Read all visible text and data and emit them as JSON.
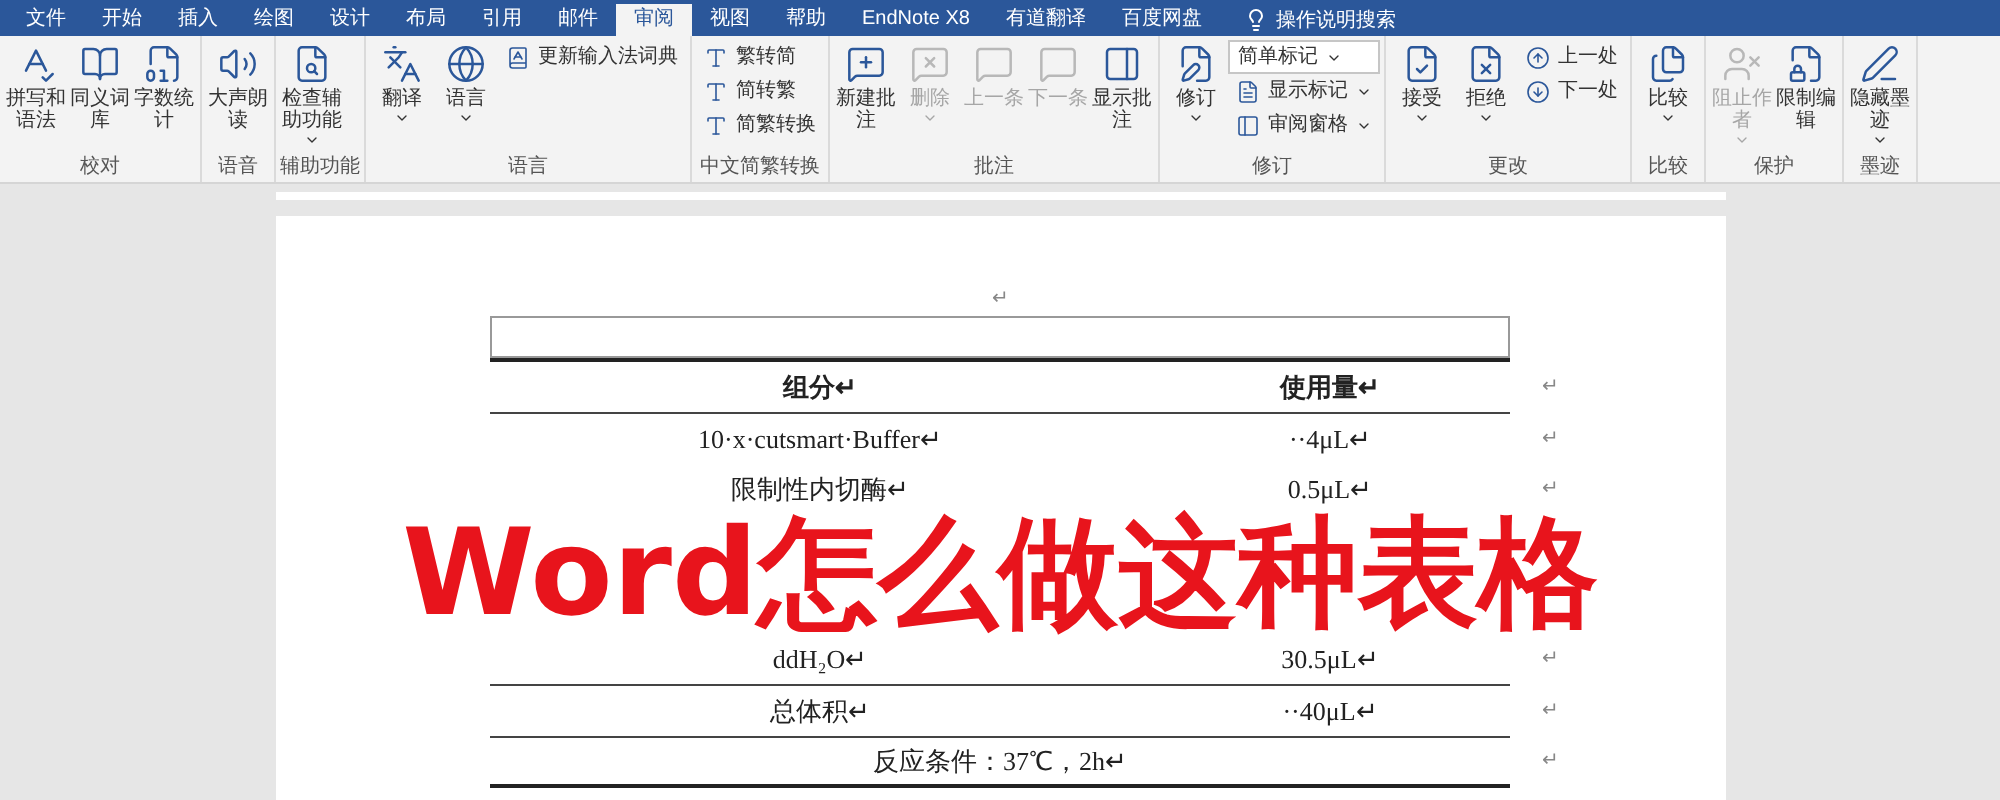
{
  "menu_tabs": [
    {
      "label": "文件",
      "selected": false
    },
    {
      "label": "开始",
      "selected": false
    },
    {
      "label": "插入",
      "selected": false
    },
    {
      "label": "绘图",
      "selected": false
    },
    {
      "label": "设计",
      "selected": false
    },
    {
      "label": "布局",
      "selected": false
    },
    {
      "label": "引用",
      "selected": false
    },
    {
      "label": "邮件",
      "selected": false
    },
    {
      "label": "审阅",
      "selected": true
    },
    {
      "label": "视图",
      "selected": false
    },
    {
      "label": "帮助",
      "selected": false
    },
    {
      "label": "EndNote X8",
      "selected": false
    },
    {
      "label": "有道翻译",
      "selected": false
    },
    {
      "label": "百度网盘",
      "selected": false
    }
  ],
  "tell_me": {
    "placeholder": "操作说明搜索"
  },
  "ribbon_groups": [
    {
      "label": "校对",
      "items": [
        {
          "kind": "large",
          "label": "拼写和语法",
          "disabled": false,
          "dropdown": false
        },
        {
          "kind": "large",
          "label": "同义词库",
          "disabled": false,
          "dropdown": false
        },
        {
          "kind": "large",
          "label": "字数统计",
          "disabled": false,
          "dropdown": false
        }
      ]
    },
    {
      "label": "语音",
      "items": [
        {
          "kind": "large",
          "label": "大声朗读",
          "disabled": false,
          "dropdown": false
        }
      ]
    },
    {
      "label": "辅助功能",
      "items": [
        {
          "kind": "large",
          "label": "检查辅助功能",
          "disabled": false,
          "dropdown": true
        }
      ]
    },
    {
      "label": "语言",
      "items": [
        {
          "kind": "large",
          "label": "翻译",
          "disabled": false,
          "dropdown": true
        },
        {
          "kind": "large",
          "label": "语言",
          "disabled": false,
          "dropdown": true
        },
        {
          "kind": "small",
          "label": "更新输入法词典",
          "disabled": false,
          "dropdown": false
        }
      ]
    },
    {
      "label": "中文简繁转换",
      "items": [
        {
          "kind": "small",
          "label": "繁转简",
          "disabled": false,
          "dropdown": false
        },
        {
          "kind": "small",
          "label": "简转繁",
          "disabled": false,
          "dropdown": false
        },
        {
          "kind": "small",
          "label": "简繁转换",
          "disabled": false,
          "dropdown": false
        }
      ]
    },
    {
      "label": "批注",
      "items": [
        {
          "kind": "large",
          "label": "新建批注",
          "disabled": false,
          "dropdown": false
        },
        {
          "kind": "large",
          "label": "删除",
          "disabled": true,
          "dropdown": true
        },
        {
          "kind": "large",
          "label": "上一条",
          "disabled": true,
          "dropdown": false
        },
        {
          "kind": "large",
          "label": "下一条",
          "disabled": true,
          "dropdown": false
        },
        {
          "kind": "large",
          "label": "显示批注",
          "disabled": false,
          "dropdown": false
        }
      ]
    },
    {
      "label": "修订",
      "items": [
        {
          "kind": "large",
          "label": "修订",
          "disabled": false,
          "dropdown": true
        },
        {
          "kind": "select",
          "label": "简单标记",
          "disabled": false,
          "dropdown": true
        },
        {
          "kind": "small",
          "label": "显示标记",
          "disabled": false,
          "dropdown": true
        },
        {
          "kind": "small",
          "label": "审阅窗格",
          "disabled": false,
          "dropdown": true
        }
      ]
    },
    {
      "label": "更改",
      "items": [
        {
          "kind": "large",
          "label": "接受",
          "disabled": false,
          "dropdown": true
        },
        {
          "kind": "large",
          "label": "拒绝",
          "disabled": false,
          "dropdown": true
        },
        {
          "kind": "small",
          "label": "上一处",
          "disabled": false,
          "dropdown": false
        },
        {
          "kind": "small",
          "label": "下一处",
          "disabled": false,
          "dropdown": false
        }
      ]
    },
    {
      "label": "比较",
      "items": [
        {
          "kind": "large",
          "label": "比较",
          "disabled": false,
          "dropdown": true
        }
      ]
    },
    {
      "label": "保护",
      "items": [
        {
          "kind": "large",
          "label": "阻止作者",
          "disabled": true,
          "dropdown": true
        },
        {
          "kind": "large",
          "label": "限制编辑",
          "disabled": false,
          "dropdown": false
        }
      ]
    },
    {
      "label": "墨迹",
      "items": [
        {
          "kind": "large",
          "label": "隐藏墨迹",
          "disabled": false,
          "dropdown": true
        }
      ]
    }
  ],
  "document": {
    "paragraph_mark": "↵",
    "table": {
      "header": {
        "cells": [
          "组分↵",
          "使用量↵"
        ],
        "end_mark": "↵"
      },
      "rows_above": [
        {
          "cells": [
            "10·x·cutsmart·Buffer↵",
            "··4μL↵"
          ],
          "end_mark": "↵"
        },
        {
          "cells": [
            "限制性内切酶↵",
            "0.5μL↵"
          ],
          "end_mark": "↵"
        }
      ],
      "rows_below": [
        {
          "cells": [
            "ddH₂O↵",
            "30.5μL↵"
          ],
          "end_mark": "↵"
        },
        {
          "cells": [
            "总体积↵",
            "··40μL↵"
          ],
          "end_mark": "↵"
        }
      ],
      "footer": {
        "text": "反应条件：37℃，2h↵",
        "end_mark": "↵"
      }
    }
  },
  "overlay_title": "Word怎么做这种表格"
}
